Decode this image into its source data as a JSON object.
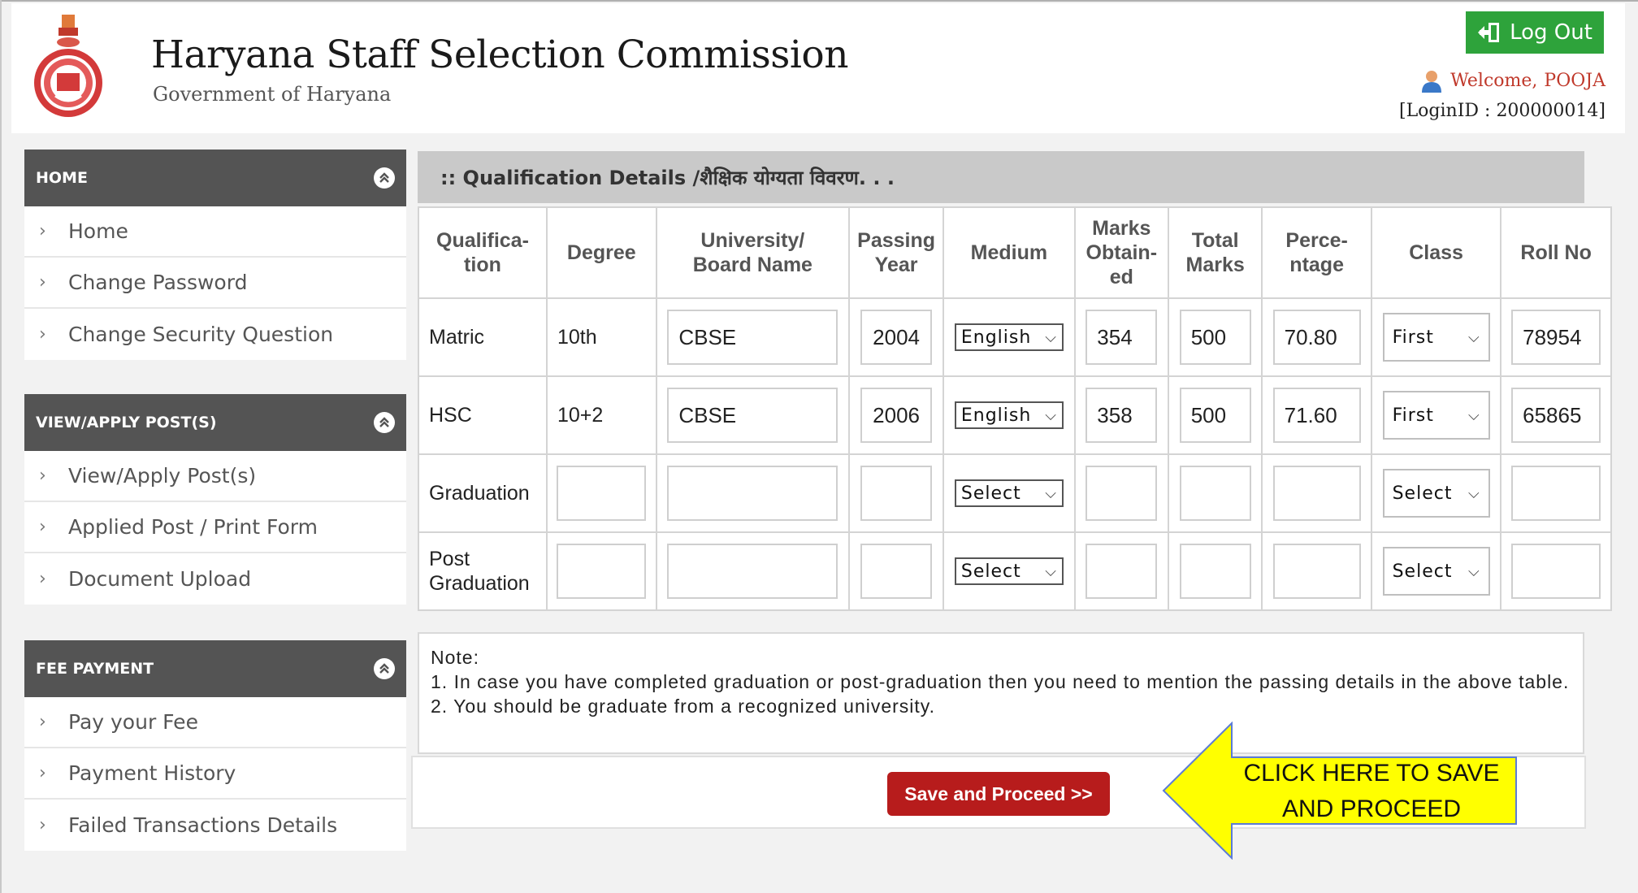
{
  "header": {
    "site_title": "Haryana Staff Selection Commission",
    "site_subtitle": "Government of Haryana",
    "logout_label": "Log Out",
    "welcome_prefix": "Welcome,",
    "user_name": "POOJA",
    "login_id": "[LoginID : 200000014]"
  },
  "sidebar": {
    "panels": [
      {
        "title": "HOME",
        "items": [
          "Home",
          "Change Password",
          "Change Security Question"
        ]
      },
      {
        "title": "VIEW/APPLY POST(S)",
        "items": [
          "View/Apply Post(s)",
          "Applied Post / Print Form",
          "Document Upload"
        ]
      },
      {
        "title": "FEE PAYMENT",
        "items": [
          "Pay your Fee",
          "Payment History",
          "Failed Transactions Details"
        ]
      }
    ]
  },
  "main": {
    "section_title": ":: Qualification Details /शैक्षिक योग्यता विवरण. . .",
    "columns": [
      "Qualifica-\ntion",
      "Degree",
      "University/\nBoard Name",
      "Passing\nYear",
      "Medium",
      "Marks\nObtain-\ned",
      "Total\nMarks",
      "Perce-\nntage",
      "Class",
      "Roll No"
    ],
    "rows": [
      {
        "qualification": "Matric",
        "degree": "10th",
        "university": "CBSE",
        "year": "2004",
        "medium": "English",
        "marks": "354",
        "total": "500",
        "percentage": "70.80",
        "class": "First",
        "roll": "78954"
      },
      {
        "qualification": "HSC",
        "degree": "10+2",
        "university": "CBSE",
        "year": "2006",
        "medium": "English",
        "marks": "358",
        "total": "500",
        "percentage": "71.60",
        "class": "First",
        "roll": "65865"
      },
      {
        "qualification": "Graduation",
        "degree": "",
        "university": "",
        "year": "",
        "medium": "Select",
        "marks": "",
        "total": "",
        "percentage": "",
        "class": "Select",
        "roll": ""
      },
      {
        "qualification": "Post\nGraduation",
        "degree": "",
        "university": "",
        "year": "",
        "medium": "Select",
        "marks": "",
        "total": "",
        "percentage": "",
        "class": "Select",
        "roll": ""
      }
    ],
    "note_title": "Note:",
    "note_1": "1. In case you have completed graduation or post-graduation then you need to mention the passing details in the above table.",
    "note_2": "2. You should be graduate from a recognized university.",
    "save_label": "Save and Proceed >>"
  },
  "callout": {
    "text": "CLICK HERE TO SAVE AND PROCEED",
    "fill": "#ffff00",
    "stroke": "#5b7bd6"
  },
  "colors": {
    "panel_header": "#545454",
    "logout_green": "#2ea33b",
    "save_red": "#b71c1c",
    "section_bar": "#c9c9c9"
  }
}
